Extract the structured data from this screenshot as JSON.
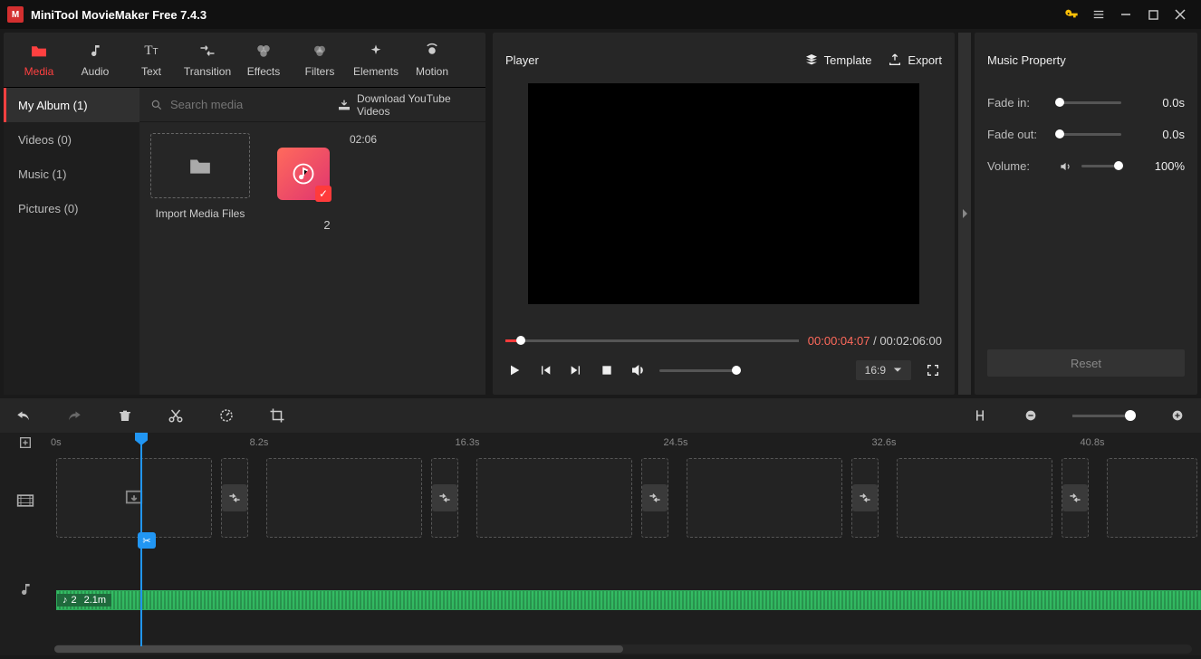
{
  "titlebar": {
    "app_title": "MiniTool MovieMaker Free 7.4.3"
  },
  "tabs": [
    {
      "id": "media",
      "label": "Media",
      "active": true
    },
    {
      "id": "audio",
      "label": "Audio",
      "active": false
    },
    {
      "id": "text",
      "label": "Text",
      "active": false
    },
    {
      "id": "transition",
      "label": "Transition",
      "active": false
    },
    {
      "id": "effects",
      "label": "Effects",
      "active": false
    },
    {
      "id": "filters",
      "label": "Filters",
      "active": false
    },
    {
      "id": "elements",
      "label": "Elements",
      "active": false
    },
    {
      "id": "motion",
      "label": "Motion",
      "active": false
    }
  ],
  "sidebar": {
    "items": [
      {
        "label": "My Album (1)",
        "active": true
      },
      {
        "label": "Videos (0)",
        "active": false
      },
      {
        "label": "Music (1)",
        "active": false
      },
      {
        "label": "Pictures (0)",
        "active": false
      }
    ]
  },
  "search": {
    "placeholder": "Search media"
  },
  "yt_download": "Download YouTube Videos",
  "import": {
    "label": "Import Media Files"
  },
  "clip": {
    "duration": "02:06",
    "name": "2"
  },
  "player": {
    "title": "Player",
    "template_label": "Template",
    "export_label": "Export",
    "current_time": "00:00:04:07",
    "sep": " / ",
    "total_time": "00:02:06:00",
    "aspect": "16:9"
  },
  "props": {
    "title": "Music Property",
    "fade_in_label": "Fade in:",
    "fade_in_value": "0.0s",
    "fade_out_label": "Fade out:",
    "fade_out_value": "0.0s",
    "volume_label": "Volume:",
    "volume_value": "100%",
    "reset_label": "Reset"
  },
  "timeline": {
    "ticks": [
      "0s",
      "8.2s",
      "16.3s",
      "24.5s",
      "32.6s",
      "40.8s"
    ],
    "audio_clip": {
      "number": "2",
      "length": "2.1m"
    }
  }
}
